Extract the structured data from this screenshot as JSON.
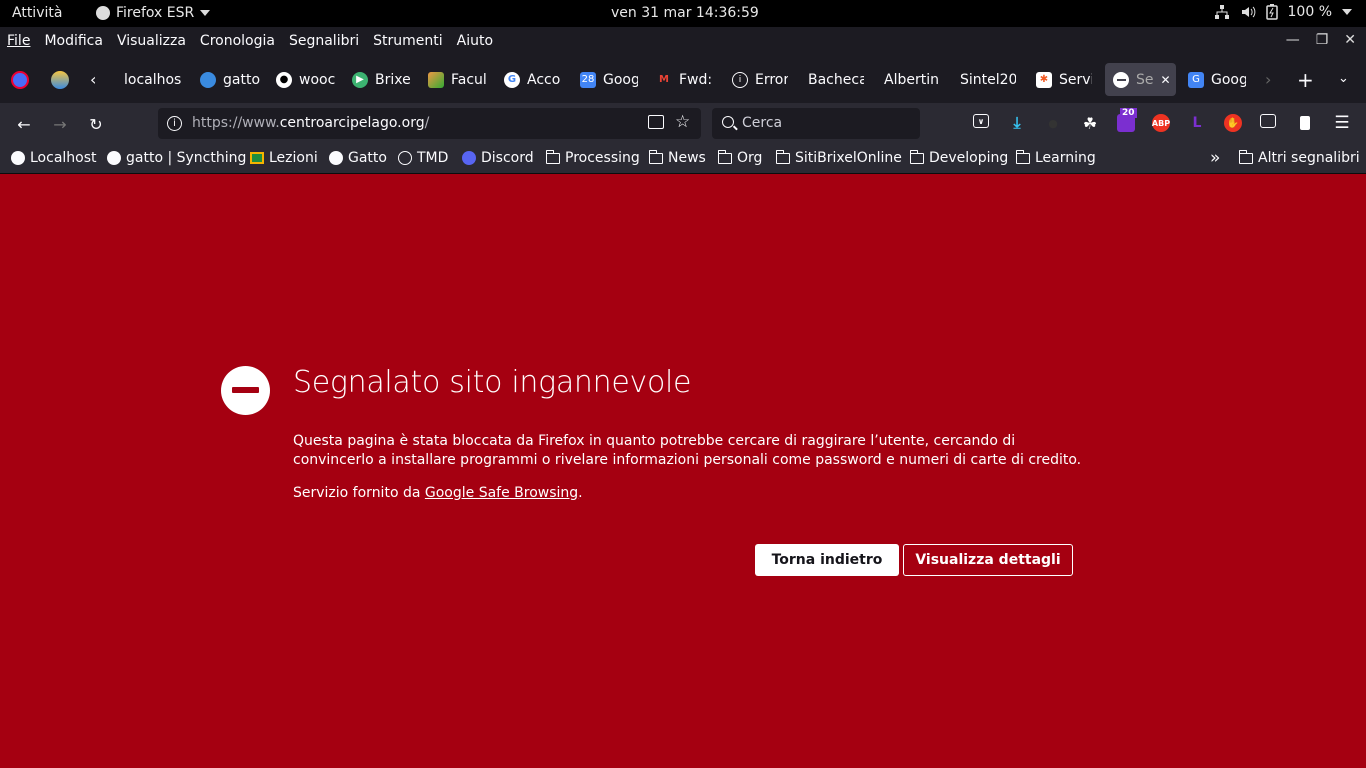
{
  "topbar": {
    "activities": "Attività",
    "app_name": "Firefox ESR",
    "clock": "ven 31 mar  14:36:59",
    "battery": "100 %"
  },
  "menubar": {
    "items": [
      "File",
      "Modifica",
      "Visualizza",
      "Cronologia",
      "Segnalibri",
      "Strumenti",
      "Aiuto"
    ]
  },
  "tabs": [
    {
      "label": "localhos"
    },
    {
      "label": "gatto"
    },
    {
      "label": "wooc"
    },
    {
      "label": "Brixe"
    },
    {
      "label": "Facul"
    },
    {
      "label": "Acco"
    },
    {
      "label": "Goog"
    },
    {
      "label": "Fwd:"
    },
    {
      "label": "Error"
    },
    {
      "label": "Bacheca"
    },
    {
      "label": "Albertin"
    },
    {
      "label": "Sintel20"
    },
    {
      "label": "Servi"
    },
    {
      "label": "Se"
    },
    {
      "label": "Goog"
    }
  ],
  "navbar": {
    "url_prefix": "https://www.",
    "url_host": "centroarcipelago.org",
    "url_suffix": "/",
    "search_placeholder": "Cerca",
    "badge_count": "20"
  },
  "bookmarks": {
    "items": [
      "Localhost",
      "gatto | Syncthing",
      "Lezioni",
      "Gatto",
      "TMD",
      "Discord",
      "Processing",
      "News",
      "Org",
      "SitiBrixelOnline",
      "Developing",
      "Learning"
    ],
    "other": "Altri segnalibri"
  },
  "error": {
    "title": "Segnalato sito ingannevole",
    "description": "Questa pagina è stata bloccata da Firefox in quanto potrebbe cercare di raggirare l’utente, cercando di convincerlo a installare programmi o rivelare informazioni personali come password e numeri di carte di credito.",
    "source_prefix": "Servizio fornito da ",
    "source_link": "Google Safe Browsing",
    "source_suffix": ".",
    "back_button": "Torna indietro",
    "details_button": "Visualizza dettagli"
  },
  "colors": {
    "page_bg": "#a50011",
    "toolbar_bg": "#2b2a33",
    "tabstrip_bg": "#1c1b22"
  }
}
